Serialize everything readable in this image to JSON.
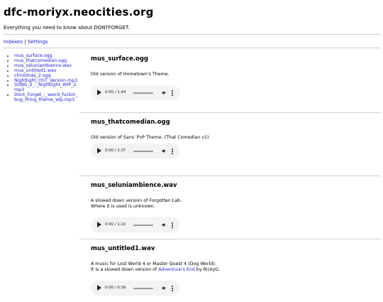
{
  "site": {
    "title": "dfc-moriyx.neocities.org",
    "tagline": "Everything you need to know about DONTFORGET."
  },
  "nav": {
    "indexes": "Indexes",
    "separator": "|",
    "settings": "Settings"
  },
  "sidebar": {
    "items": [
      {
        "label": "mus_surface.ogg"
      },
      {
        "label": "mus_thatcomedian.ogg"
      },
      {
        "label": "mus_seluniambience.wav"
      },
      {
        "label": "mus_untitled1.wav"
      },
      {
        "label": "christmas_2.ogg"
      },
      {
        "label": "Nightlight_OST_Version.mp3"
      },
      {
        "label": "SONG_2_-_Nightlight_WIP_2.mp3"
      },
      {
        "label": "Dont_Forget_-_weird_fuckin_bug_thing_theme_wip.mp3"
      }
    ]
  },
  "entries": [
    {
      "title": "mus_surface.ogg",
      "description_lines": [
        "Old version of Hometown's Theme."
      ],
      "player": {
        "time": "0:00 / 1:44",
        "progress": 0
      }
    },
    {
      "title": "mus_thatcomedian.ogg",
      "description_lines": [
        "Old version of Sans' PvP Theme. (That Comedian v1)"
      ],
      "player": {
        "time": "0:00 / 2:37",
        "progress": 0
      }
    },
    {
      "title": "mus_seluniambience.wav",
      "description_lines": [
        "A slowed down version of Forgotten Lab.",
        "Where it is used is unknown."
      ],
      "player": {
        "time": "0:00 / 1:22",
        "progress": 0
      }
    },
    {
      "title": "mus_untitled1.wav",
      "description_lines": [
        "A music for Lost World 4 or Master Quest 4 (Dog World)."
      ],
      "description_link_line": {
        "before": "It is a slowed down version of ",
        "link": "Adventure's End",
        "after": " by RickyG."
      },
      "player": {
        "time": "0:00 / 0:39",
        "progress": 0
      }
    }
  ],
  "icons": {
    "play": "play-icon",
    "volume": "volume-icon",
    "more": "more-options-icon"
  }
}
